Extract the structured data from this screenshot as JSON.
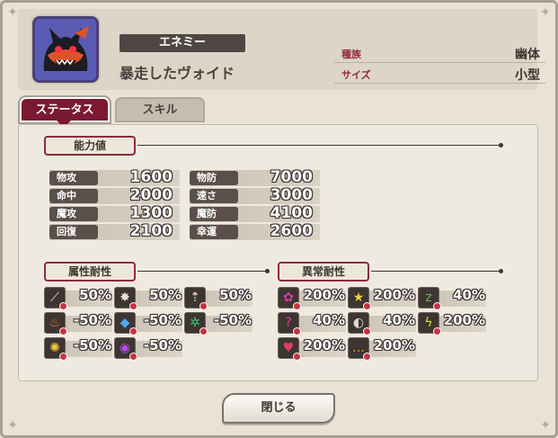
{
  "header": {
    "type_badge": "エネミー",
    "enemy_name": "暴走したヴォイド",
    "info": [
      {
        "key": "種族",
        "value": "幽体"
      },
      {
        "key": "サイズ",
        "value": "小型"
      }
    ]
  },
  "tabs": [
    {
      "label": "ステータス",
      "active": true
    },
    {
      "label": "スキル",
      "active": false
    }
  ],
  "sections": {
    "ability": "能力値",
    "element": "属性耐性",
    "status": "異常耐性"
  },
  "stats": [
    {
      "label": "物攻",
      "value": "1600"
    },
    {
      "label": "命中",
      "value": "2000"
    },
    {
      "label": "魔攻",
      "value": "1300"
    },
    {
      "label": "回復",
      "value": "2100"
    },
    {
      "label": "物防",
      "value": "7000"
    },
    {
      "label": "速さ",
      "value": "3000"
    },
    {
      "label": "魔防",
      "value": "4100"
    },
    {
      "label": "幸運",
      "value": "2600"
    }
  ],
  "element_resist": [
    {
      "icon": "slash-icon",
      "value": "50%",
      "color": "#e8e2d6"
    },
    {
      "icon": "strike-icon",
      "value": "50%",
      "color": "#e8e2d6"
    },
    {
      "icon": "pierce-icon",
      "value": "50%",
      "color": "#e8e2d6"
    },
    {
      "icon": "fire-icon",
      "value": "-50%",
      "color": "#f07a2a"
    },
    {
      "icon": "water-icon",
      "value": "-50%",
      "color": "#4aa8f0"
    },
    {
      "icon": "wind-icon",
      "value": "-50%",
      "color": "#3cc070"
    },
    {
      "icon": "light-icon",
      "value": "-50%",
      "color": "#f0c840"
    },
    {
      "icon": "dark-icon",
      "value": "-50%",
      "color": "#b050e0"
    }
  ],
  "status_resist": [
    {
      "icon": "poison-icon",
      "value": "200%",
      "color": "#d040a0"
    },
    {
      "icon": "stun-icon",
      "value": "200%",
      "color": "#f0d040"
    },
    {
      "icon": "sleep-icon",
      "value": "40%",
      "color": "#7ab060"
    },
    {
      "icon": "confuse-icon",
      "value": "40%",
      "color": "#e04090"
    },
    {
      "icon": "blind-icon",
      "value": "40%",
      "color": "#d8d8d8"
    },
    {
      "icon": "paralyze-icon",
      "value": "200%",
      "color": "#c8e020"
    },
    {
      "icon": "charm-icon",
      "value": "200%",
      "color": "#e04060"
    },
    {
      "icon": "silence-icon",
      "value": "200%",
      "color": "#e8a040"
    }
  ],
  "close_button": "閉じる"
}
